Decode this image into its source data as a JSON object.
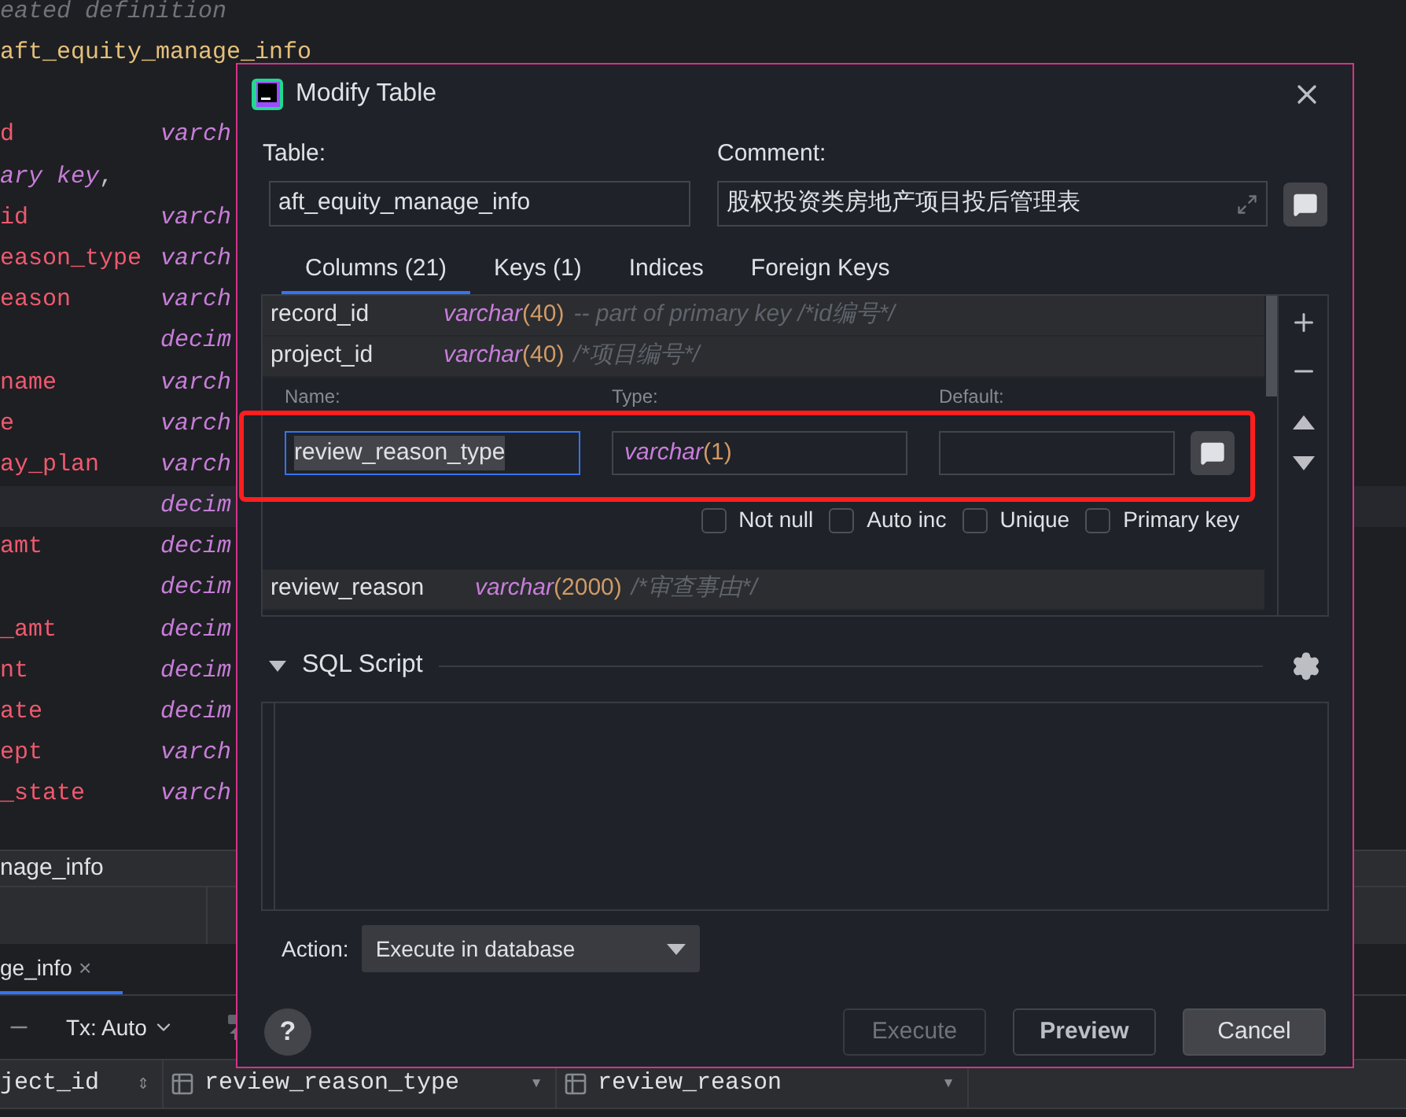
{
  "editor": {
    "lines": [
      {
        "kind": "comment",
        "name": "eated definition"
      },
      {
        "kind": "table",
        "name": "aft_equity_manage_info"
      },
      {
        "kind": "blank"
      },
      {
        "kind": "column",
        "name": "d",
        "type": "varch",
        "current": false
      },
      {
        "kind": "key",
        "name": "ary key",
        "punct": ","
      },
      {
        "kind": "column",
        "name": "id",
        "type": "varch",
        "current": false
      },
      {
        "kind": "column",
        "name": "eason_type",
        "type": "varch",
        "current": false
      },
      {
        "kind": "column",
        "name": "eason",
        "type": "varch",
        "current": false
      },
      {
        "kind": "column",
        "type": "decim",
        "current": false
      },
      {
        "kind": "column",
        "name": "name",
        "type": "varch",
        "current": false
      },
      {
        "kind": "column",
        "name": "e",
        "type": "varch",
        "current": false
      },
      {
        "kind": "column",
        "name": "ay_plan",
        "type": "varch",
        "current": false
      },
      {
        "kind": "column",
        "type": "decim",
        "current": true
      },
      {
        "kind": "column",
        "name": "amt",
        "type": "decim",
        "current": false
      },
      {
        "kind": "column",
        "type": "decim",
        "current": false
      },
      {
        "kind": "column",
        "name": "_amt",
        "type": "decim",
        "current": false
      },
      {
        "kind": "column",
        "name": "nt",
        "type": "decim",
        "current": false
      },
      {
        "kind": "column",
        "name": "ate",
        "type": "decim",
        "current": false
      },
      {
        "kind": "column",
        "name": "ept",
        "type": "varch",
        "current": false
      },
      {
        "kind": "column",
        "name": "_state",
        "type": "varch",
        "current": false
      }
    ]
  },
  "results_panel": {
    "title": "nage_info",
    "tab": {
      "label": "ge_info",
      "close": "×"
    },
    "toolbar": {
      "tx": "Tx: Auto"
    },
    "grid_columns": [
      {
        "label": "ject_id",
        "sort": "⇕"
      },
      {
        "label": "review_reason_type",
        "sort": "▾"
      },
      {
        "label": "review_reason",
        "sort": "▾"
      }
    ]
  },
  "dialog": {
    "title": "Modify Table",
    "table_label": "Table:",
    "table_value": "aft_equity_manage_info",
    "comment_label": "Comment:",
    "comment_value": "股权投资类房地产项目投后管理表",
    "tabs": [
      {
        "label": "Columns (21)",
        "selected": true
      },
      {
        "label": "Keys (1)",
        "selected": false
      },
      {
        "label": "Indices",
        "selected": false
      },
      {
        "label": "Foreign Keys",
        "selected": false
      }
    ],
    "columns": [
      {
        "name": "record_id",
        "type": "varchar",
        "length": "(40)",
        "comment": "-- part of primary key /*id编号*/"
      },
      {
        "name": "project_id",
        "type": "varchar",
        "length": "(40)",
        "comment": "/*项目编号*/"
      }
    ],
    "column_editor": {
      "name_label": "Name:",
      "name_value": "review_reason_type",
      "type_label": "Type:",
      "type_value": "varchar",
      "type_length": "(1)",
      "default_label": "Default:",
      "options": [
        {
          "label": "Not null",
          "checked": false
        },
        {
          "label": "Auto inc",
          "checked": false
        },
        {
          "label": "Unique",
          "checked": false
        },
        {
          "label": "Primary key",
          "checked": false
        }
      ]
    },
    "columns_after": [
      {
        "name": "review_reason",
        "type": "varchar",
        "length": "(2000)",
        "comment": "/*审查事由*/"
      }
    ],
    "sql_section": {
      "label": "SQL Script",
      "expanded": true
    },
    "help": "?",
    "action_label": "Action:",
    "action_value": "Execute in database",
    "buttons": [
      {
        "label": "Execute",
        "kind": "disabled"
      },
      {
        "label": "Preview",
        "kind": "bold"
      },
      {
        "label": "Cancel",
        "kind": "default"
      }
    ]
  }
}
